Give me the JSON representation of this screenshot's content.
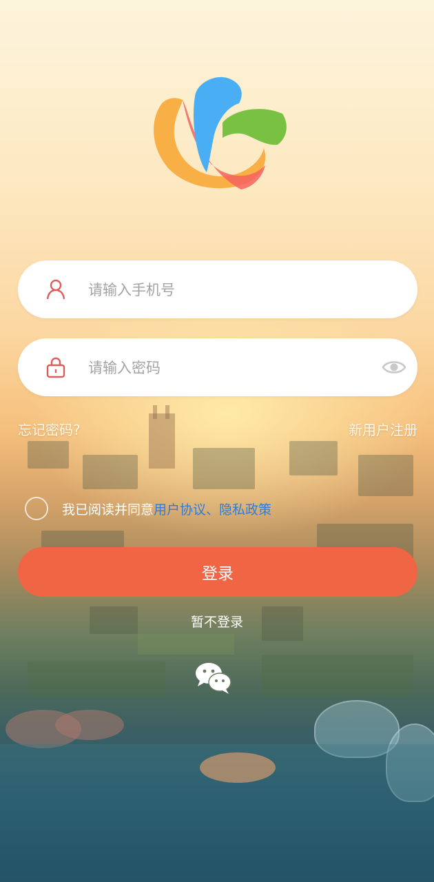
{
  "logo": {
    "icon": "city-logo-icon",
    "colors": [
      "#f8b046",
      "#4aaef5",
      "#79c142",
      "#f3635e"
    ]
  },
  "phone": {
    "placeholder": "请输入手机号",
    "icon": "user-icon"
  },
  "password": {
    "placeholder": "请输入密码",
    "icon": "lock-icon",
    "toggle_icon": "eye-icon"
  },
  "links": {
    "forgot": "忘记密码?",
    "register": "新用户注册"
  },
  "agreement": {
    "prefix": "我已阅读并同意",
    "user_agreement": "用户协议",
    "separator": "、",
    "privacy_policy": "隐私政策",
    "checked": false
  },
  "login_button": "登录",
  "skip_login": "暂不登录",
  "wechat": {
    "icon": "wechat-icon"
  },
  "colors": {
    "accent": "#f06543",
    "link": "#2f7bd8",
    "icon": "#e05a5a"
  }
}
